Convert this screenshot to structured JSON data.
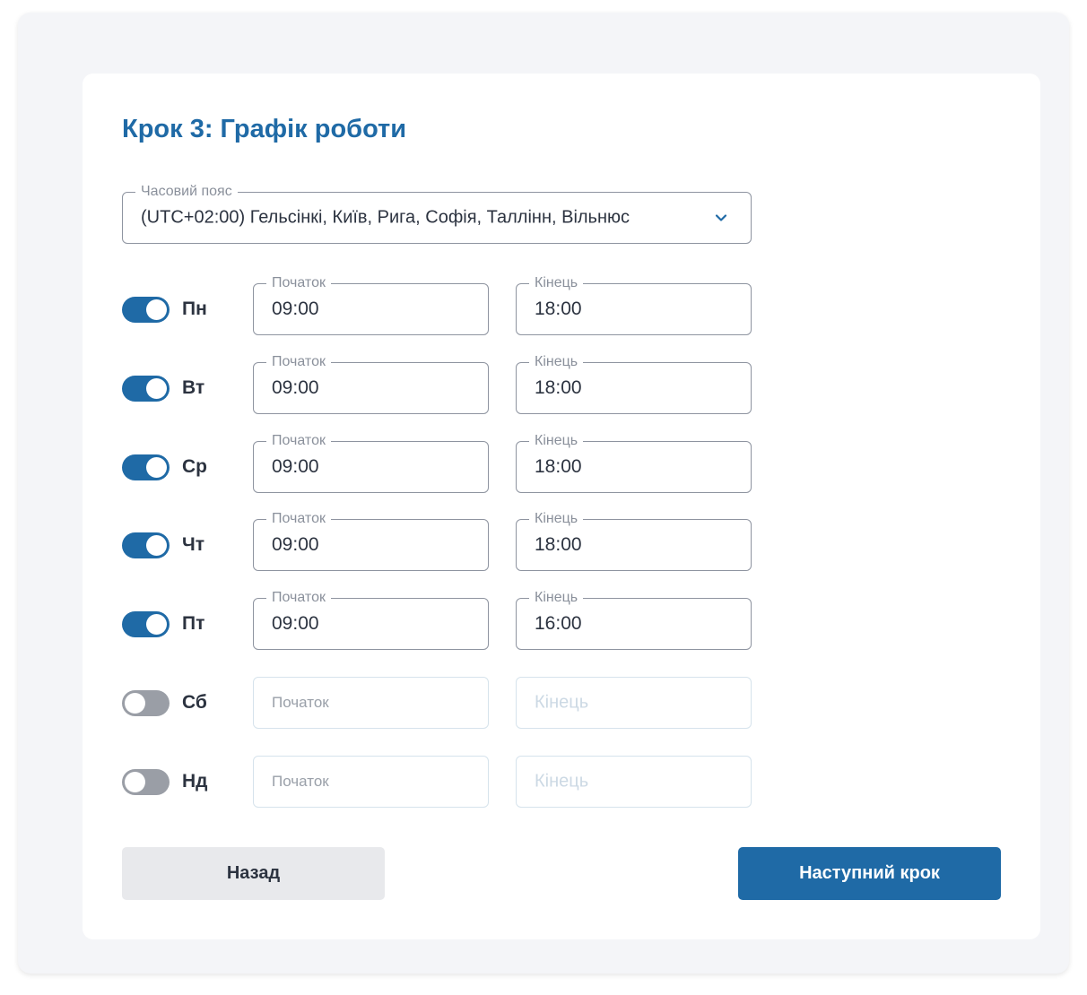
{
  "title": "Крок 3: Графік роботи",
  "timezone": {
    "label": "Часовий пояс",
    "value": "(UTC+02:00) Гельсінкі, Київ, Рига, Софія, Таллінн, Вільнюс",
    "icon": "chevron-down-icon"
  },
  "labels": {
    "start": "Початок",
    "end": "Кінець"
  },
  "days": [
    {
      "label": "Пн",
      "enabled": true,
      "start": "09:00",
      "end": "18:00"
    },
    {
      "label": "Вт",
      "enabled": true,
      "start": "09:00",
      "end": "18:00"
    },
    {
      "label": "Ср",
      "enabled": true,
      "start": "09:00",
      "end": "18:00"
    },
    {
      "label": "Чт",
      "enabled": true,
      "start": "09:00",
      "end": "18:00"
    },
    {
      "label": "Пт",
      "enabled": true,
      "start": "09:00",
      "end": "16:00"
    },
    {
      "label": "Сб",
      "enabled": false,
      "start": "",
      "end": ""
    },
    {
      "label": "Нд",
      "enabled": false,
      "start": "",
      "end": ""
    }
  ],
  "buttons": {
    "back": "Назад",
    "next": "Наступний крок"
  },
  "colors": {
    "accent": "#1f6aa6",
    "toggle_off": "#9a9ea6",
    "button_back_bg": "#e8e9ec"
  }
}
